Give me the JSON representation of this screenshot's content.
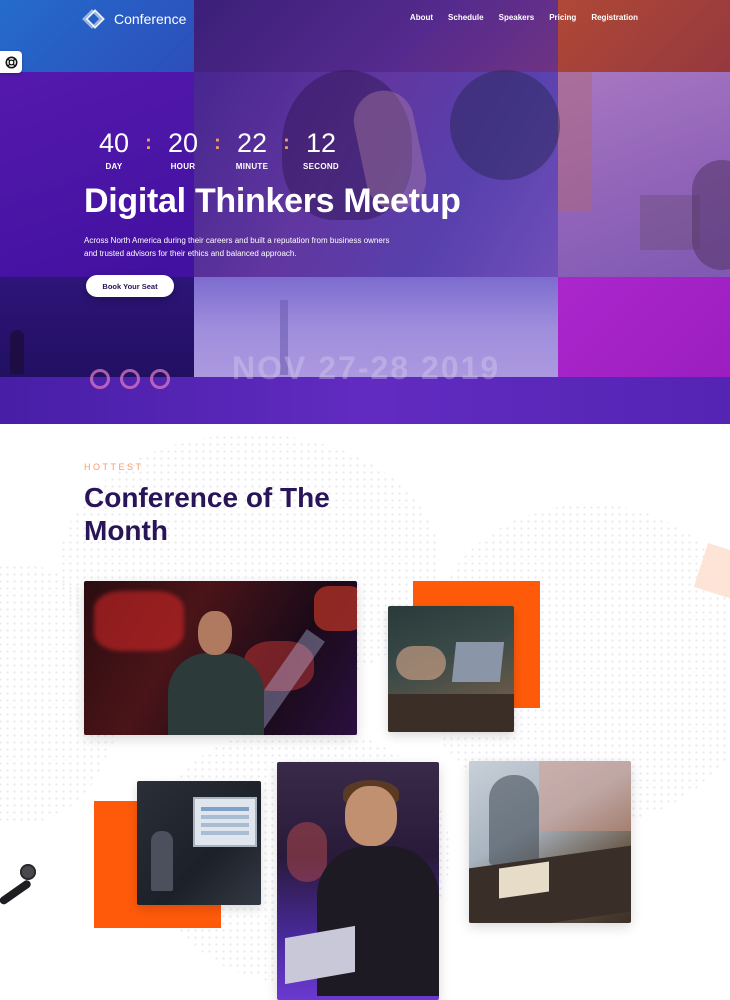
{
  "nav": {
    "brand": "Conference",
    "links": [
      "About",
      "Schedule",
      "Speakers",
      "Pricing",
      "Registration"
    ]
  },
  "hero": {
    "countdown": [
      {
        "value": "40",
        "label": "DAY"
      },
      {
        "value": "20",
        "label": "HOUR"
      },
      {
        "value": "22",
        "label": "MINUTE"
      },
      {
        "value": "12",
        "label": "SECOND"
      }
    ],
    "separator": ":",
    "title": "Digital Thinkers Meetup",
    "description": "Across North America during their careers and built a reputation from business owners and trusted advisors for their ethics and balanced approach.",
    "cta": "Book Your Seat",
    "photo_text": "NOV 27-28 2019"
  },
  "section": {
    "eyebrow": "HOTTEST",
    "title": "Conference of The Month"
  },
  "icons": {
    "help": "lifebuoy-icon",
    "logo": "logo-icon"
  },
  "colors": {
    "accent_orange": "#ff5a0a",
    "eyebrow": "#f79a6c",
    "title": "#2a1458"
  }
}
